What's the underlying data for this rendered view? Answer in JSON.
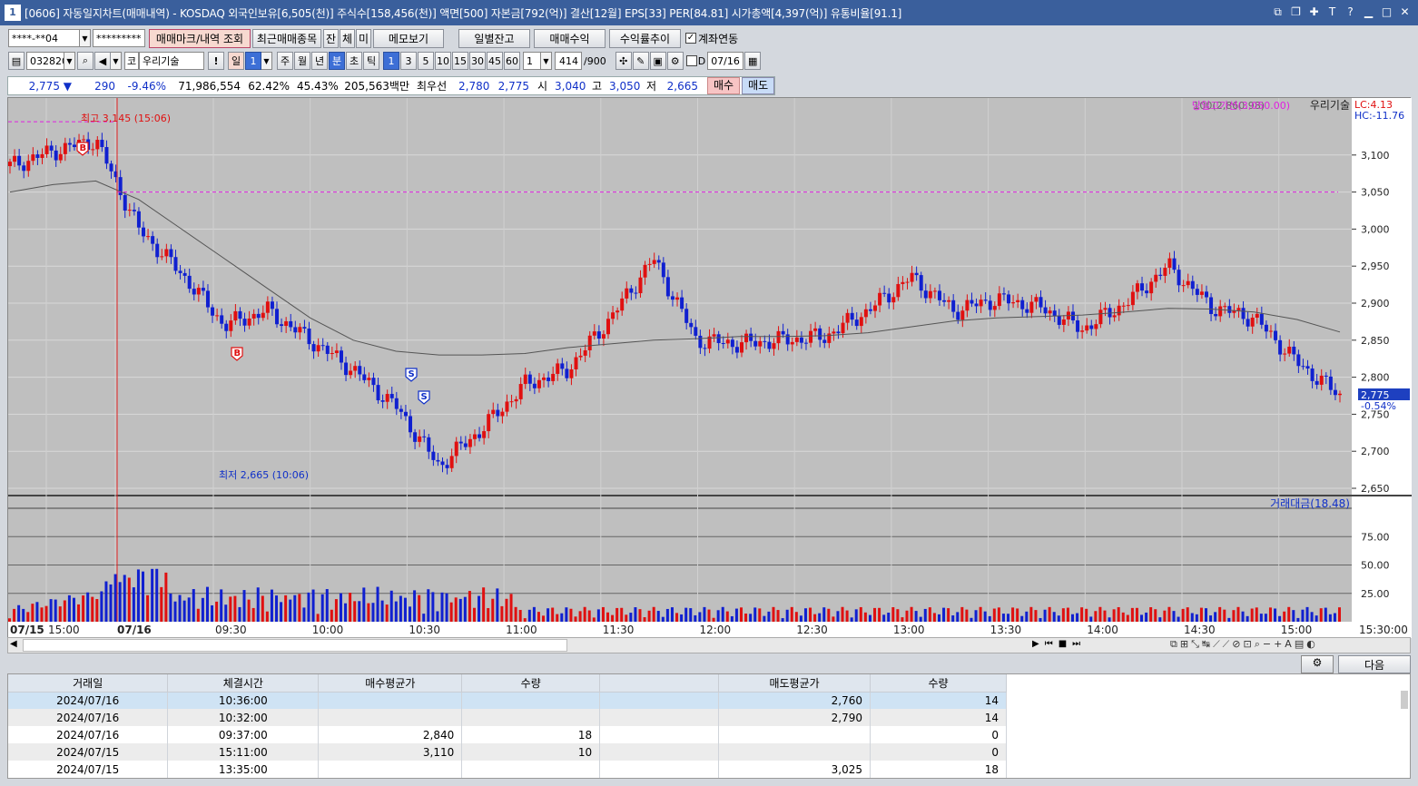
{
  "title": {
    "num": "1",
    "text": "[0606] 자동일지차트(매매내역) - KOSDAQ 외국인보유[6,505(천)] 주식수[158,456(천)] 액면[500] 자본금[792(억)] 결산[12월] EPS[33] PER[84.81] 시가총액[4,397(억)] 유통비율[91.1]"
  },
  "toolbar1": {
    "account": "****-**04",
    "password": "*********",
    "btn_mark": "매매마크/내역 조회",
    "btn_recent": "최근매매종목",
    "t1": "잔",
    "t2": "체",
    "t3": "미",
    "btn_memo": "메모보기",
    "btn_daily": "일별잔고",
    "btn_profit": "매매수익",
    "btn_rate": "수익률추이",
    "chk_link": "계좌연동"
  },
  "toolbar2": {
    "code": "032820",
    "name_prefix": "코",
    "name": "우리기술",
    "excl": "!",
    "day": "일",
    "day_val": "1",
    "periods": [
      "주",
      "월",
      "년",
      "분",
      "초",
      "틱"
    ],
    "intervals": [
      "1",
      "3",
      "5",
      "10",
      "15",
      "30",
      "45",
      "60"
    ],
    "unit_val": "1",
    "count": "414",
    "count_max": "/900",
    "date_label": "D",
    "date": "07/16"
  },
  "quote": {
    "price": "2,775 ▼",
    "change": "290",
    "rate": "-9.46%",
    "volume": "71,986,554",
    "vrate1": "62.42%",
    "vrate2": "45.43%",
    "amount": "205,563백만",
    "best_label": "최우선",
    "ask": "2,780",
    "bid": "2,775",
    "open_label": "시",
    "open": "3,040",
    "high_label": "고",
    "high": "3,050",
    "low_label": "저",
    "low": "2,665",
    "buy": "매수",
    "sell": "매도"
  },
  "chart": {
    "legend_ma": "100(2,860.98)",
    "legend_line": "당일고가선(3,050.00)",
    "legend_name": "우리기술",
    "lc": "LC:4.13",
    "hc": "HC:-11.76",
    "high_note": "최고 3,145 (15:06)",
    "low_note": "최저 2,665 (10:06)",
    "last_price": "2,775",
    "last_rate": "-0.54%",
    "vol_legend": "거래대금(18.48)",
    "price_ticks": [
      "3,100",
      "3,050",
      "3,000",
      "2,950",
      "2,900",
      "2,850",
      "2,800",
      "2,750",
      "2,700",
      "2,650"
    ],
    "vol_ticks": [
      "75.00",
      "50.00",
      "25.00"
    ],
    "time_labels": [
      "07/15",
      "15:00",
      "07/16",
      "09:30",
      "10:00",
      "10:30",
      "11:00",
      "11:30",
      "12:00",
      "12:30",
      "13:00",
      "13:30",
      "14:00",
      "14:30",
      "15:00",
      "15:30:00"
    ],
    "up_color": "#e01010",
    "down_color": "#1020d0"
  },
  "chart_data": {
    "type": "candlestick",
    "ylim": [
      2650,
      3150
    ],
    "x": [
      "07/15 14:50",
      "07/15 15:00",
      "07/15 15:06",
      "07/16 09:00",
      "07/16 09:10",
      "07/16 09:20",
      "07/16 09:30",
      "07/16 09:40",
      "07/16 09:50",
      "07/16 10:00",
      "07/16 10:06",
      "07/16 10:20",
      "07/16 10:30",
      "07/16 10:40",
      "07/16 10:50",
      "07/16 10:55",
      "07/16 11:00",
      "07/16 11:30",
      "07/16 12:00",
      "07/16 12:30",
      "07/16 12:45",
      "07/16 13:00",
      "07/16 13:15",
      "07/16 13:30",
      "07/16 13:45",
      "07/16 14:00",
      "07/16 14:15",
      "07/16 14:30",
      "07/16 14:45",
      "07/16 15:00",
      "07/16 15:10",
      "07/16 15:20"
    ],
    "close": [
      3085,
      3105,
      3120,
      3000,
      2940,
      2870,
      2890,
      2850,
      2810,
      2760,
      2680,
      2730,
      2790,
      2810,
      2880,
      2960,
      2850,
      2845,
      2850,
      2855,
      2890,
      2935,
      2890,
      2905,
      2895,
      2865,
      2900,
      2950,
      2895,
      2880,
      2820,
      2775
    ],
    "ma100": [
      3050,
      3060,
      3065,
      3040,
      3000,
      2960,
      2920,
      2880,
      2850,
      2835,
      2830,
      2830,
      2832,
      2840,
      2845,
      2850,
      2852,
      2855,
      2855,
      2856,
      2860,
      2868,
      2876,
      2880,
      2882,
      2884,
      2888,
      2893,
      2892,
      2888,
      2878,
      2861
    ],
    "day_high_line": 3050,
    "trades": [
      {
        "type": "B",
        "time": "07/15 15:11"
      },
      {
        "type": "B",
        "time": "07/16 09:37"
      },
      {
        "type": "S",
        "time": "07/16 10:32"
      },
      {
        "type": "S",
        "time": "07/16 10:36"
      }
    ]
  },
  "scrollbar_tools": "◀ ▶",
  "bottom": {
    "btn_next": "다음",
    "headers": [
      "거래일",
      "체결시간",
      "매수평균가",
      "수량",
      "",
      "매도평균가",
      "수량"
    ],
    "rows": [
      [
        "2024/07/16",
        "10:36:00",
        "",
        "",
        "",
        "2,760",
        "14"
      ],
      [
        "2024/07/16",
        "10:32:00",
        "",
        "",
        "",
        "2,790",
        "14"
      ],
      [
        "2024/07/16",
        "09:37:00",
        "2,840",
        "18",
        "",
        "",
        "0"
      ],
      [
        "2024/07/15",
        "15:11:00",
        "3,110",
        "10",
        "",
        "",
        "0"
      ],
      [
        "2024/07/15",
        "13:35:00",
        "",
        "",
        "",
        "3,025",
        "18"
      ]
    ]
  }
}
